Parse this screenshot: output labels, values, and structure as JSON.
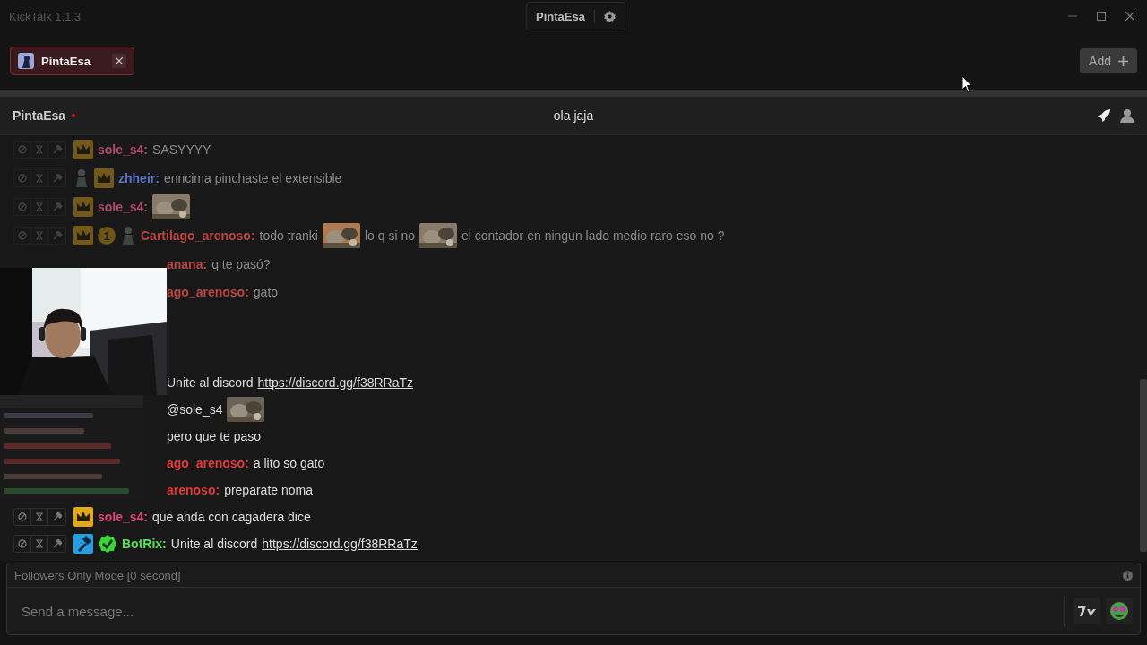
{
  "app": {
    "title": "KickTalk 1.1.3",
    "user": "PintaEsa"
  },
  "tabs": [
    {
      "label": "PintaEsa",
      "selected": true
    }
  ],
  "add_button": {
    "label": "Add"
  },
  "channel": {
    "name": "PintaEsa",
    "live": true,
    "title": "ola jaja"
  },
  "older_messages": [
    {
      "kind": "full",
      "faded": true,
      "badges": [
        {
          "kind": "crown"
        }
      ],
      "user": "sole_s4:",
      "color": "#b04a6a",
      "parts": [
        {
          "kind": "text",
          "text": "SASYYYY"
        }
      ]
    },
    {
      "kind": "full",
      "faded": true,
      "badges": [
        {
          "kind": "figure"
        },
        {
          "kind": "crown"
        }
      ],
      "user": "zhheir:",
      "color": "#5a72c8",
      "parts": [
        {
          "kind": "text",
          "text": "enncima pinchaste el extensible"
        }
      ]
    },
    {
      "kind": "full",
      "faded": true,
      "badges": [
        {
          "kind": "crown"
        }
      ],
      "user": "sole_s4:",
      "color": "#b04a6a",
      "parts": [
        {
          "kind": "emote"
        }
      ]
    },
    {
      "kind": "full",
      "faded": true,
      "badges": [
        {
          "kind": "crown"
        },
        {
          "kind": "number",
          "text": "1"
        },
        {
          "kind": "figure"
        }
      ],
      "user": "Cartilago_arenoso:",
      "color": "#b84444",
      "parts": [
        {
          "kind": "text",
          "text": "todo tranki"
        },
        {
          "kind": "emote"
        },
        {
          "kind": "text",
          "text": "lo q si no"
        },
        {
          "kind": "emote"
        },
        {
          "kind": "text",
          "text": "el contador en ningun lado medio raro eso no ?"
        }
      ]
    },
    {
      "kind": "partial",
      "faded": true,
      "user": "anana:",
      "color": "#b84444",
      "parts": [
        {
          "kind": "text",
          "text": "q te pasó?"
        }
      ]
    },
    {
      "kind": "partial",
      "faded": true,
      "user": "ago_arenoso:",
      "color": "#b84444",
      "parts": [
        {
          "kind": "text",
          "text": "gato"
        }
      ]
    }
  ],
  "recent_messages": [
    {
      "kind": "partial",
      "faded": false,
      "parts": [
        {
          "kind": "text",
          "text": "Unite al discord"
        },
        {
          "kind": "link",
          "text": "https://discord.gg/f38RRaTz"
        }
      ]
    },
    {
      "kind": "partial",
      "faded": false,
      "parts": [
        {
          "kind": "text",
          "text": "@sole_s4"
        },
        {
          "kind": "emote"
        }
      ]
    },
    {
      "kind": "partial",
      "faded": false,
      "parts": [
        {
          "kind": "text",
          "text": "pero que te paso"
        }
      ]
    },
    {
      "kind": "partial",
      "faded": false,
      "user": "ago_arenoso:",
      "color": "#e03a3a",
      "parts": [
        {
          "kind": "text",
          "text": "a lito so gato"
        }
      ]
    },
    {
      "kind": "partial",
      "faded": false,
      "user": "arenoso:",
      "color": "#e03a3a",
      "parts": [
        {
          "kind": "text",
          "text": "preparate noma"
        }
      ]
    },
    {
      "kind": "full",
      "faded": false,
      "badges": [
        {
          "kind": "crown"
        }
      ],
      "user": "sole_s4:",
      "color": "#e0457b",
      "parts": [
        {
          "kind": "text",
          "text": "que anda con cagadera dice"
        }
      ]
    },
    {
      "kind": "full",
      "faded": false,
      "badges": [
        {
          "kind": "bot"
        },
        {
          "kind": "verified"
        }
      ],
      "user": "BotRix:",
      "color": "#5be05b",
      "parts": [
        {
          "kind": "text",
          "text": "Unite al discord"
        },
        {
          "kind": "link",
          "text": "https://discord.gg/f38RRaTz"
        }
      ]
    }
  ],
  "chat_mode": "Followers Only Mode [0 second]",
  "composer": {
    "placeholder": "Send a message..."
  }
}
